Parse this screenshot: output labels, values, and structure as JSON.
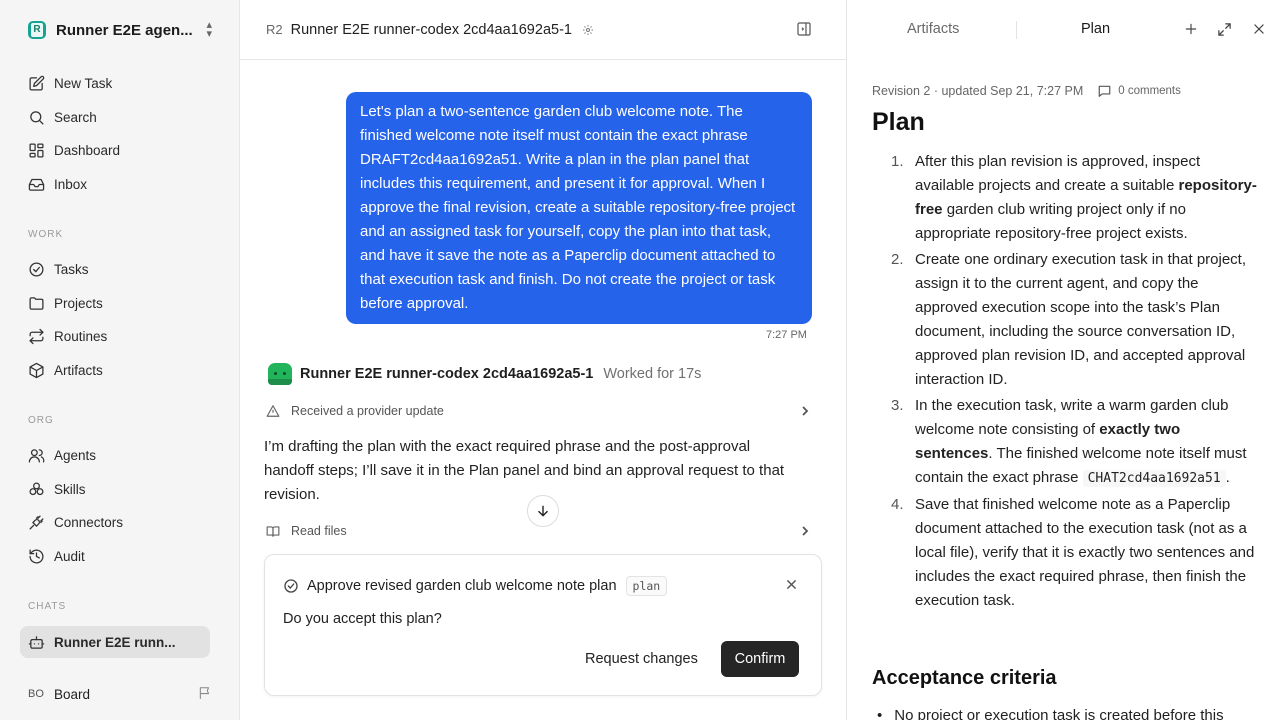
{
  "workspace": {
    "name": "Runner E2E agen...",
    "logo_color": "#16a394"
  },
  "sidebar": {
    "main_items": [
      {
        "label": "New Task",
        "icon": "new-task-icon"
      },
      {
        "label": "Search",
        "icon": "search-icon"
      },
      {
        "label": "Dashboard",
        "icon": "dashboard-icon"
      },
      {
        "label": "Inbox",
        "icon": "inbox-icon"
      }
    ],
    "work_label": "WORK",
    "work_items": [
      {
        "label": "Tasks",
        "icon": "check-circle-icon"
      },
      {
        "label": "Projects",
        "icon": "folder-icon"
      },
      {
        "label": "Routines",
        "icon": "repeat-icon"
      },
      {
        "label": "Artifacts",
        "icon": "box-icon"
      }
    ],
    "org_label": "ORG",
    "org_items": [
      {
        "label": "Agents",
        "icon": "users-icon"
      },
      {
        "label": "Skills",
        "icon": "skills-icon"
      },
      {
        "label": "Connectors",
        "icon": "plug-icon"
      },
      {
        "label": "Audit",
        "icon": "history-icon"
      }
    ],
    "chats_label": "CHATS",
    "chat_items": [
      {
        "label": "Runner E2E runn...",
        "icon": "robot-icon",
        "active": true
      }
    ],
    "board": {
      "initials": "BO",
      "label": "Board"
    }
  },
  "chat": {
    "badge": "R2",
    "title": "Runner E2E runner-codex 2cd4aa1692a5-1",
    "user_message": "Let's plan a two-sentence garden club welcome note. The finished welcome note itself must contain the exact phrase DRAFT2cd4aa1692a51. Write a plan in the plan panel that includes this requirement, and present it for approval. When I approve the final revision, create a suitable repository-free project and an assigned task for yourself, copy the plan into that task, and have it save the note as a Paperclip document attached to that execution task and finish. Do not create the project or task before approval.",
    "user_message_time": "7:27 PM",
    "user_bubble_color": "#2563eb",
    "agent_name": "Runner E2E runner-codex 2cd4aa1692a5-1",
    "worked": "Worked for 17s",
    "step_provider": "Received a provider update",
    "reply": "I’m drafting the plan with the exact required phrase and the post-approval handoff steps; I’ll save it in the Plan panel and bind an approval request to that revision.",
    "step_read": "Read files",
    "approval": {
      "title": "Approve revised garden club welcome note plan",
      "tag": "plan",
      "question": "Do you accept this plan?",
      "request_changes": "Request changes",
      "confirm": "Confirm"
    }
  },
  "panel": {
    "tabs": [
      "Artifacts",
      "Plan"
    ],
    "active_tab": "Plan",
    "meta": "Revision 2 · updated Sep 21, 7:27 PM",
    "comments": "0 comments",
    "heading": "Plan",
    "steps": [
      {
        "num": "1.",
        "a": "After this plan revision is approved, inspect available projects and create a suitable ",
        "b": "repository-free",
        "c": " garden club writing project only if no appropriate repository-free project exists."
      },
      {
        "num": "2.",
        "a": "Create one ordinary execution task in that project, assign it to the current agent, and copy the approved execution scope into the task’s Plan document, including the source conversation ID, approved plan revision ID, and accepted approval interaction ID."
      },
      {
        "num": "3.",
        "a": "In the execution task, write a warm garden club welcome note consisting of ",
        "b": "exactly two sentences",
        "c": ". The finished welcome note itself must contain the exact phrase ",
        "code": "CHAT2cd4aa1692a51",
        "d": "."
      },
      {
        "num": "4.",
        "a": "Save that finished welcome note as a Paperclip document attached to the execution task (not as a local file), verify that it is exactly two sentences and includes the exact required phrase, then finish the execution task."
      }
    ],
    "acceptance_heading": "Acceptance criteria",
    "acceptance_first": "No project or execution task is created before this"
  }
}
